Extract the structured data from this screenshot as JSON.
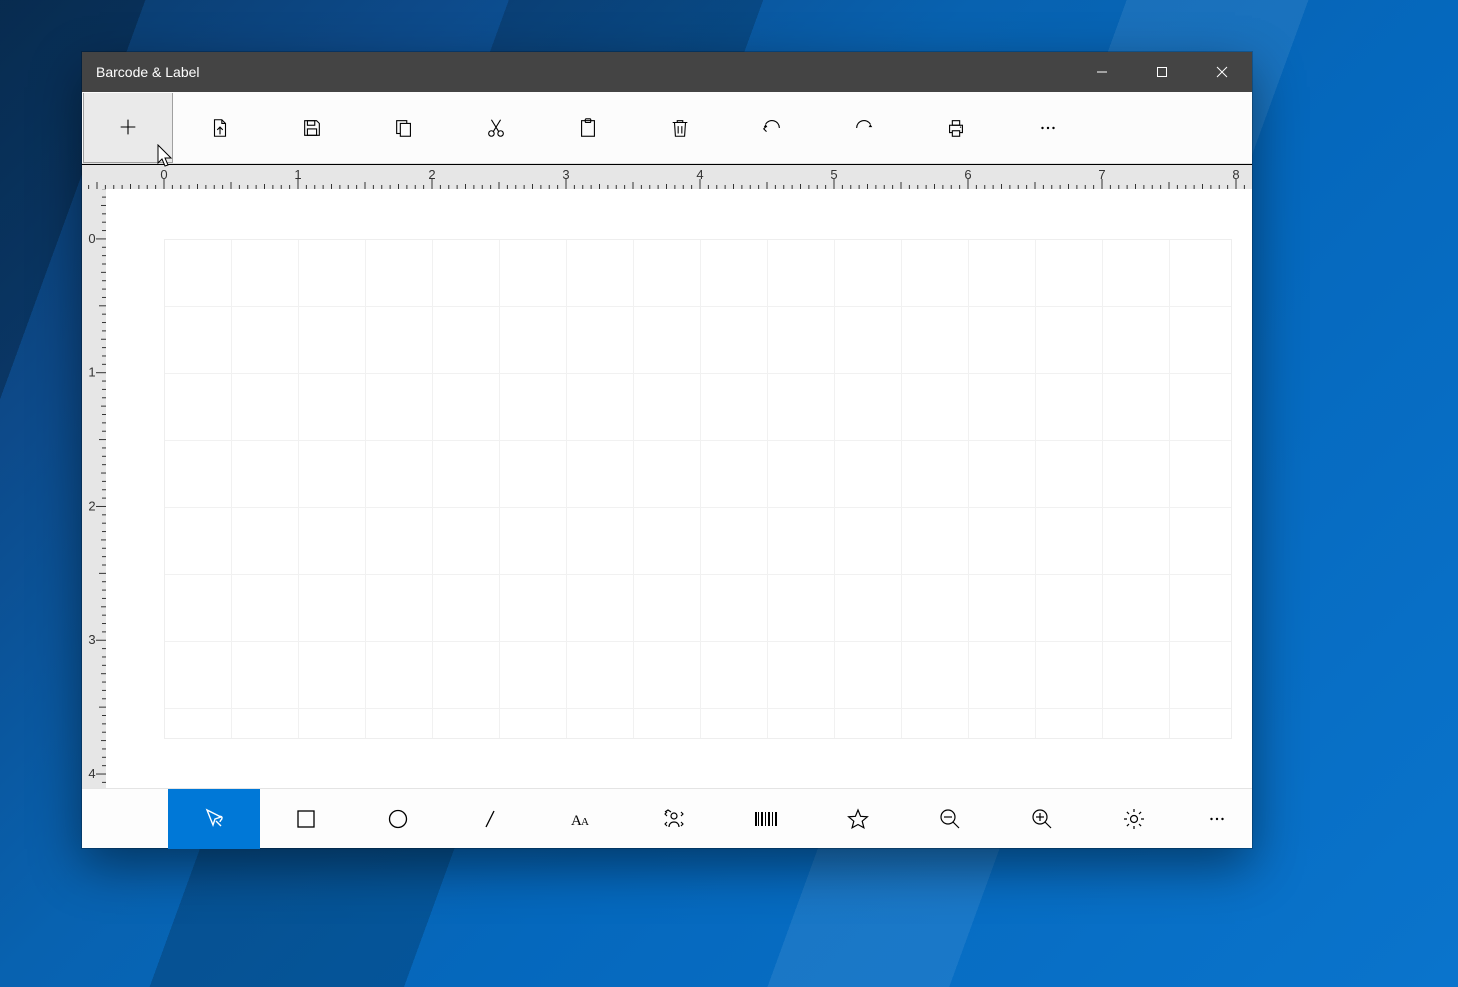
{
  "titlebar": {
    "title": "Barcode & Label"
  },
  "ruler": {
    "horizontal_labels": [
      "0",
      "1",
      "2",
      "3",
      "4",
      "5",
      "6",
      "7",
      "8"
    ],
    "vertical_labels": [
      "0",
      "1",
      "2",
      "3",
      "4"
    ]
  },
  "toolbar_top": {
    "items": [
      {
        "name": "new"
      },
      {
        "name": "open"
      },
      {
        "name": "save"
      },
      {
        "name": "copy"
      },
      {
        "name": "cut"
      },
      {
        "name": "paste"
      },
      {
        "name": "delete"
      },
      {
        "name": "undo"
      },
      {
        "name": "redo"
      },
      {
        "name": "print"
      },
      {
        "name": "more"
      }
    ]
  },
  "toolbar_bottom": {
    "items": [
      {
        "name": "select"
      },
      {
        "name": "rectangle"
      },
      {
        "name": "ellipse"
      },
      {
        "name": "line"
      },
      {
        "name": "text"
      },
      {
        "name": "image"
      },
      {
        "name": "barcode"
      },
      {
        "name": "star"
      },
      {
        "name": "zoom-out"
      },
      {
        "name": "zoom-in"
      },
      {
        "name": "settings"
      },
      {
        "name": "more"
      }
    ]
  }
}
